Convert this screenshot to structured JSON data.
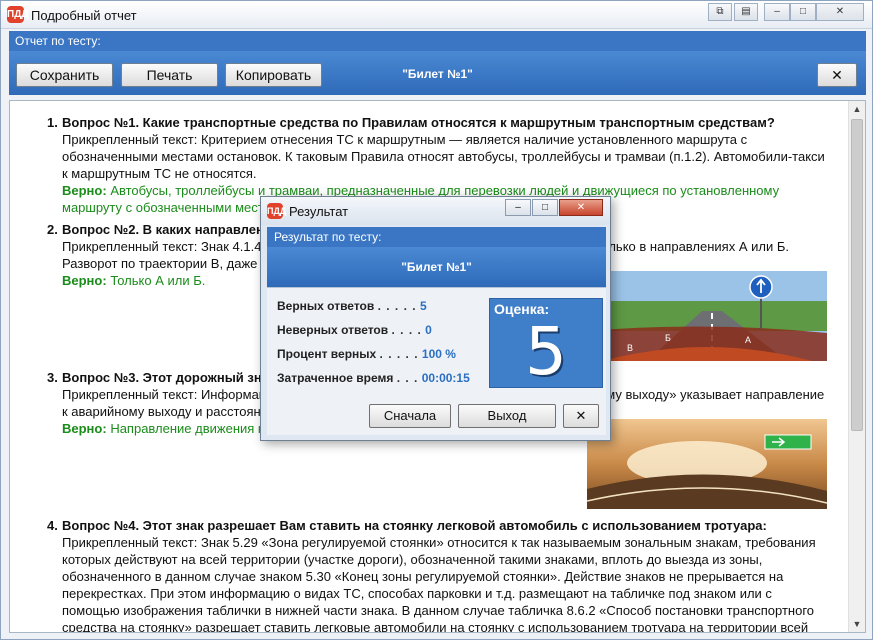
{
  "window": {
    "icon": "app-logo-icon",
    "icon_text": "ПДД",
    "title": "Подробный отчет",
    "controls": {
      "restore": "⧉",
      "pin": "▤",
      "minimize": "–",
      "maximize": "□",
      "close": "✕"
    }
  },
  "header": {
    "panel_title": "Отчет по тесту:",
    "ticket": "\"Билет №1\""
  },
  "toolbar": {
    "save": "Сохранить",
    "print": "Печать",
    "copy": "Копировать",
    "close": "✕"
  },
  "questions": [
    {
      "num": "1.",
      "title": "Вопрос №1. Какие транспортные средства по Правилам относятся к маршрутным транспортным средствам?",
      "attached": "Прикрепленный текст: Критерием отнесения ТС к маршрутным — является наличие установленного маршрута с обозначенными местами остановок. К таковым Правила относят автобусы, троллейбусы и трамваи (п.1.2). Автомобили-такси к маршрутным ТС не относятся.",
      "correct_label": "Верно:",
      "correct": "Автобусы, троллейбусы и трамваи, предназначенные для перевозки людей и движущиеся по установленному маршруту с обозначенными местами остановок."
    },
    {
      "num": "2.",
      "title": "Вопрос №2. В каких направлениях Вам разрешено продолжить движение?",
      "attached": "Прикрепленный текст: Знак 4.1.4 «Движение прямо или направо» разрешает движение только в направлениях А или Б. Разворот по траектории В, даже с учетом разметки, запрещен.",
      "correct_label": "Верно:",
      "correct": "Только А или Б."
    },
    {
      "num": "3.",
      "title": "Вопрос №3. Этот дорожный знак указывает:",
      "attached": "Прикрепленный текст: Информационный знак 6.17.2 «Направление движения к аварийному выходу» указывает направление к аварийному выходу и расстояние до него.",
      "correct_label": "Верно:",
      "correct": "Направление движения к аварийному выходу."
    },
    {
      "num": "4.",
      "title": "Вопрос №4. Этот знак разрешает Вам ставить на стоянку легковой автомобиль с использованием тротуара:",
      "attached": "Прикрепленный текст: Знак 5.29 «Зона регулируемой стоянки» относится к так называемым зональным знакам, требования которых действуют на всей территории (участке дороги), обозначенной такими знаками, вплоть до выезда из зоны, обозначенного в данном случае знаком 5.30 «Конец зоны регулируемой стоянки». Действие знаков не прерывается на перекрестках. При этом информацию о видах ТС, способах парковки и т.д. размещают на табличке под знаком или с помощью изображения таблички в нижней части знака. В данном случае табличка 8.6.2 «Способ постановки транспортного средства на стоянку» разрешает ставить легковые автомобили на стоянку с использованием тротуара на территории всей"
    }
  ],
  "scrollbar": {
    "up": "▲",
    "down": "▼"
  },
  "dialog": {
    "icon_text": "ПДД",
    "title": "Результат",
    "controls": {
      "minimize": "–",
      "maximize": "□",
      "close": "✕"
    },
    "panel_title": "Результат по тесту:",
    "ticket": "\"Билет №1\"",
    "stats": [
      {
        "label": "Верных ответов",
        "dots": ". . . . .",
        "value": "5"
      },
      {
        "label": "Неверных ответов",
        "dots": ". . . .",
        "value": "0"
      },
      {
        "label": "Процент верных",
        "dots": ". . . . .",
        "value": "100 %"
      },
      {
        "label": "Затраченное время",
        "dots": ". . .",
        "value": "00:00:15"
      }
    ],
    "grade_label": "Оценка:",
    "grade_value": "5",
    "buttons": {
      "restart": "Сначала",
      "exit": "Выход",
      "close": "✕"
    }
  },
  "colors": {
    "accent": "#3a76c4",
    "correct": "#1a8c1a",
    "value": "#2a6fc2"
  }
}
